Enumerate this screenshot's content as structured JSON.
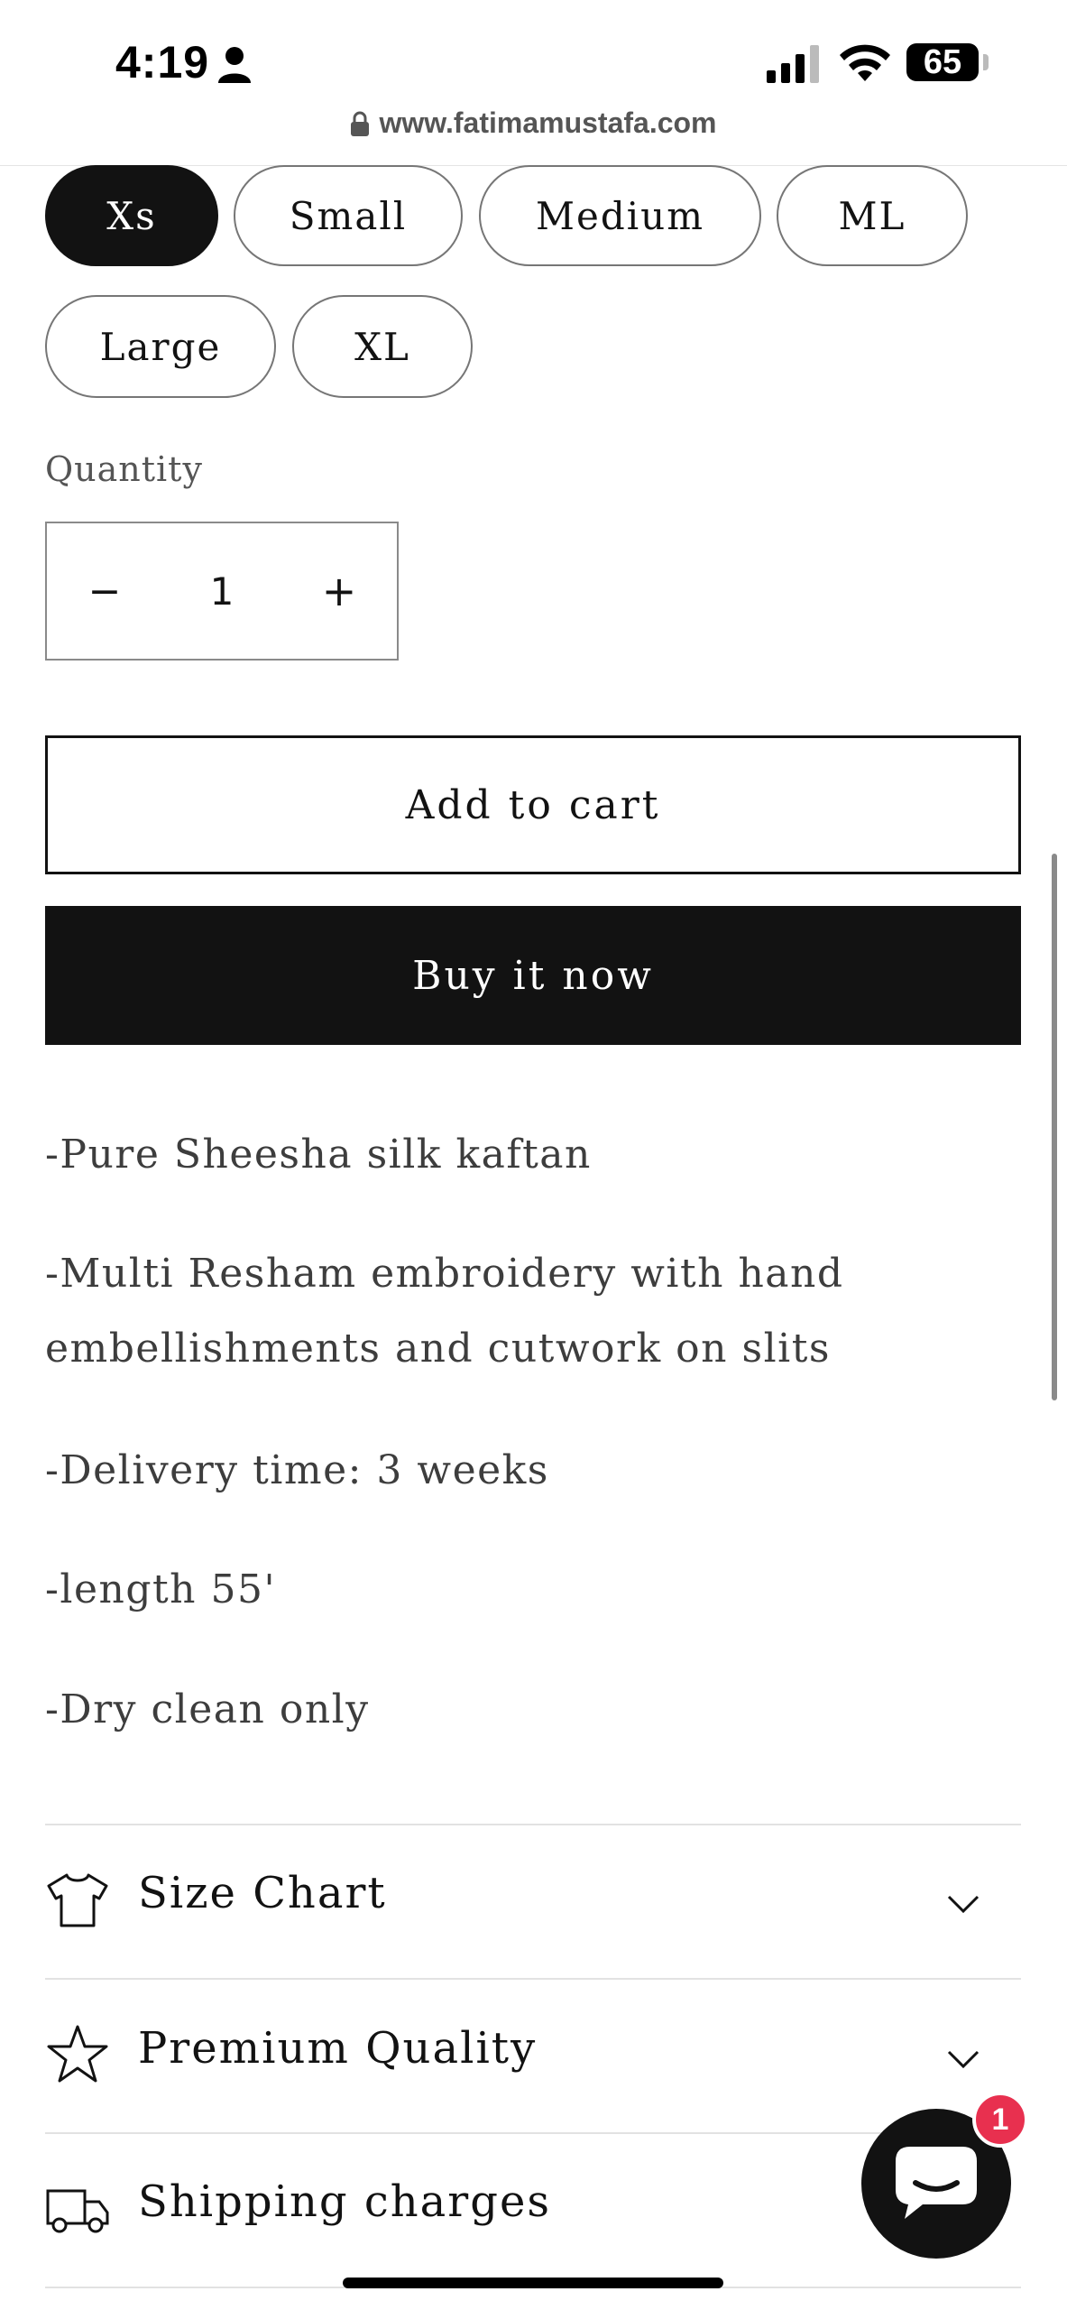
{
  "status_bar": {
    "time": "4:19",
    "battery": "65",
    "url": "www.fatimamustafa.com"
  },
  "sizes": {
    "options": [
      "Xs",
      "Small",
      "Medium",
      "ML",
      "Large",
      "XL"
    ],
    "selected": "Xs"
  },
  "quantity": {
    "label": "Quantity",
    "value": "1",
    "minus": "−",
    "plus": "+"
  },
  "buttons": {
    "add_to_cart": "Add to cart",
    "buy_now": "Buy it now"
  },
  "description": [
    "-Pure Sheesha silk kaftan",
    "-Multi Resham embroidery with hand embellishments and cutwork on slits",
    "-Delivery time: 3 weeks",
    "-length 55'",
    "-Dry clean only"
  ],
  "accordion": [
    {
      "label": "Size Chart",
      "icon": "tshirt-icon"
    },
    {
      "label": "Premium Quality",
      "icon": "star-icon"
    },
    {
      "label": "Shipping charges",
      "icon": "truck-icon"
    }
  ],
  "chat": {
    "badge_count": "1"
  },
  "colors": {
    "primary": "#121212",
    "badge": "#e8304f",
    "text_secondary": "#3d3d3d"
  }
}
